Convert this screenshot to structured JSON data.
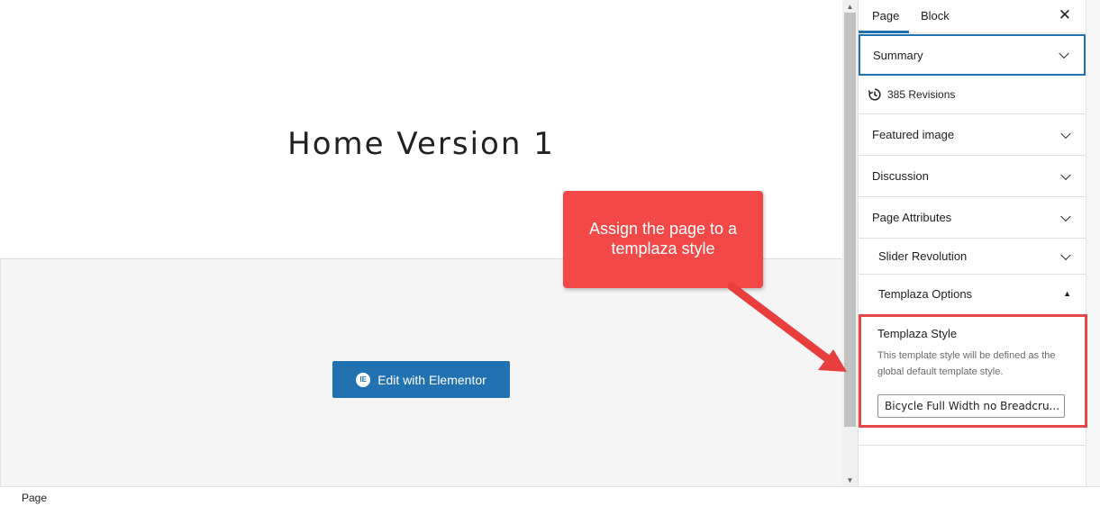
{
  "canvas": {
    "page_title": "Home Version 1",
    "edit_button_label": "Edit with Elementor",
    "edit_button_icon": "elementor-icon"
  },
  "sidebar": {
    "tabs": [
      {
        "label": "Page",
        "active": true
      },
      {
        "label": "Block",
        "active": false
      }
    ],
    "close_icon": "close-icon",
    "panels": {
      "summary": "Summary",
      "revisions": "385 Revisions",
      "featured_image": "Featured image",
      "discussion": "Discussion",
      "page_attributes": "Page Attributes",
      "slider_revolution": "Slider Revolution",
      "templaza_options": "Templaza Options"
    },
    "templaza_style": {
      "label": "Templaza Style",
      "help": "This template style will be defined as the global default template style.",
      "selected": "Bicycle Full Width no Breadcru..."
    }
  },
  "callout": {
    "text": "Assign the page to a templaza style",
    "color": "#f24848"
  },
  "statusbar": {
    "label": "Page"
  },
  "colors": {
    "accent": "#2271b1",
    "highlight": "#e24848"
  }
}
